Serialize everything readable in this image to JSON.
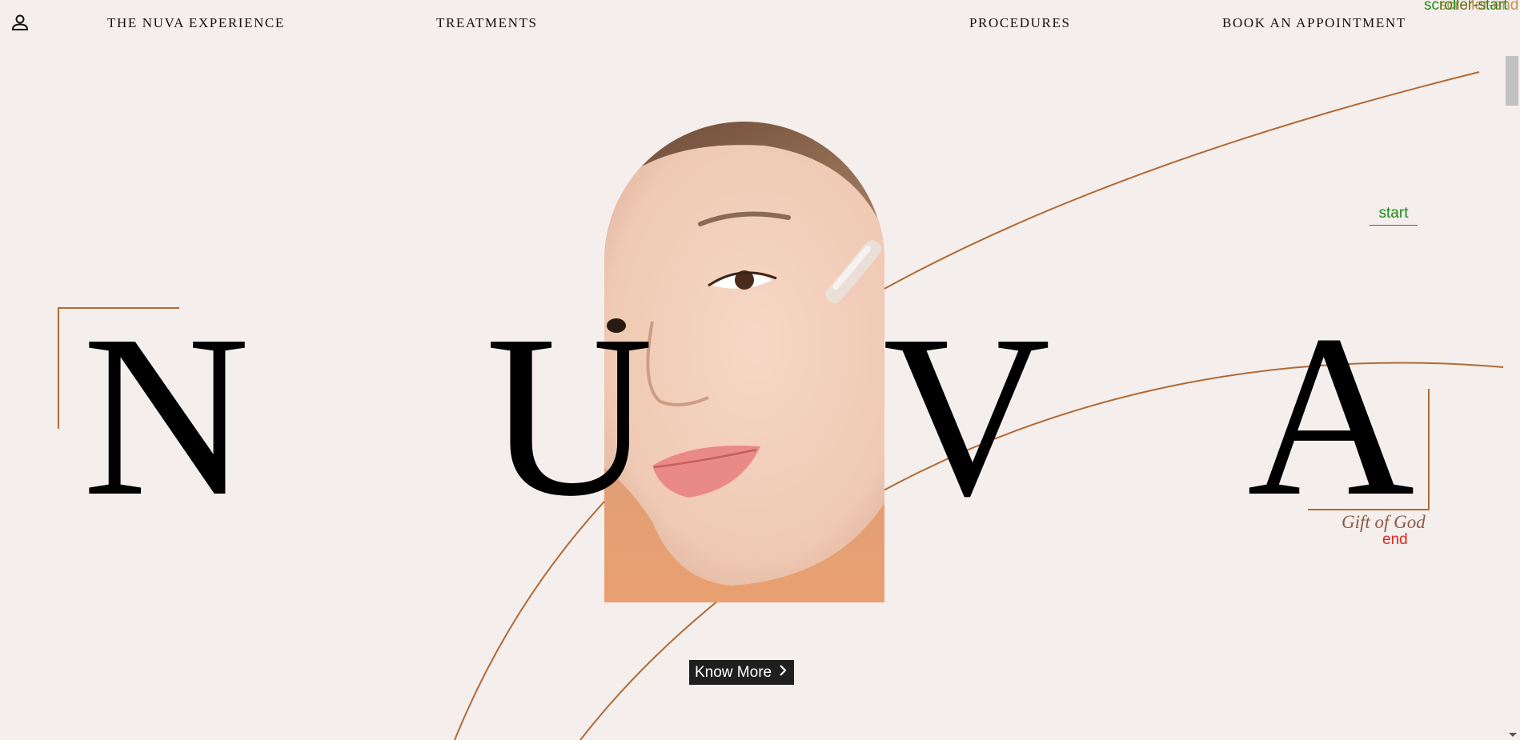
{
  "nav": {
    "items": [
      "THE NUVA EXPERIENCE",
      "TREATMENTS",
      "PROCEDURES",
      "BOOK AN APPOINTMENT"
    ],
    "user_icon": "user-icon"
  },
  "hero": {
    "letters": [
      "N",
      "U",
      "V",
      "A"
    ],
    "tagline": "Gift of God",
    "image_alt": "woman-face-serum-dropper",
    "cta_label": "Know More",
    "cta_icon": "chevron-right-icon"
  },
  "debug_markers": {
    "start": "start",
    "end": "end",
    "scroller_start": "scroller-start",
    "scroller_end": "scroller-end"
  },
  "colors": {
    "background": "#f4eeec",
    "accent_line": "#b06a36",
    "button_bg": "#1f1f1f",
    "marker_start": "#1a8a1a",
    "marker_end": "#e0261d"
  }
}
